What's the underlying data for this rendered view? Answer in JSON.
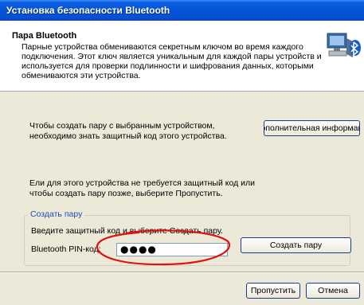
{
  "window": {
    "title": "Установка безопасности Bluetooth"
  },
  "header": {
    "title": "Пара Bluetooth",
    "description": "Парные устройства обмениваются секретным ключом во время каждого подключения. Этот ключ является уникальным для каждой пары устройств и используется для проверки подлинности и шифрования данных, которыми обмениваются эти устройства.",
    "icon": "bluetooth-computer-icon"
  },
  "pairing_text": "Чтобы создать пару с выбранным устройством, необходимо знать защитный код этого устройства.",
  "more_info_button": "ополнительная информац",
  "skip_text": "Ели для этого устройства не требуется защитный код или чтобы создать пару позже, выберите Пропустить.",
  "group": {
    "title": "Создать пару",
    "instruction": "Введите защитный код и выберите Создать пару.",
    "pin_label": "Bluetooth PIN-код:",
    "pin_value": "●●●●",
    "create_button": "Создать пару"
  },
  "footer": {
    "skip_button": "Пропустить",
    "cancel_button": "Отмена"
  },
  "colors": {
    "titlebar": "#0454d6",
    "dialog_bg": "#ece9d8",
    "group_title": "#1f4bbf",
    "annotation": "#e01010"
  }
}
